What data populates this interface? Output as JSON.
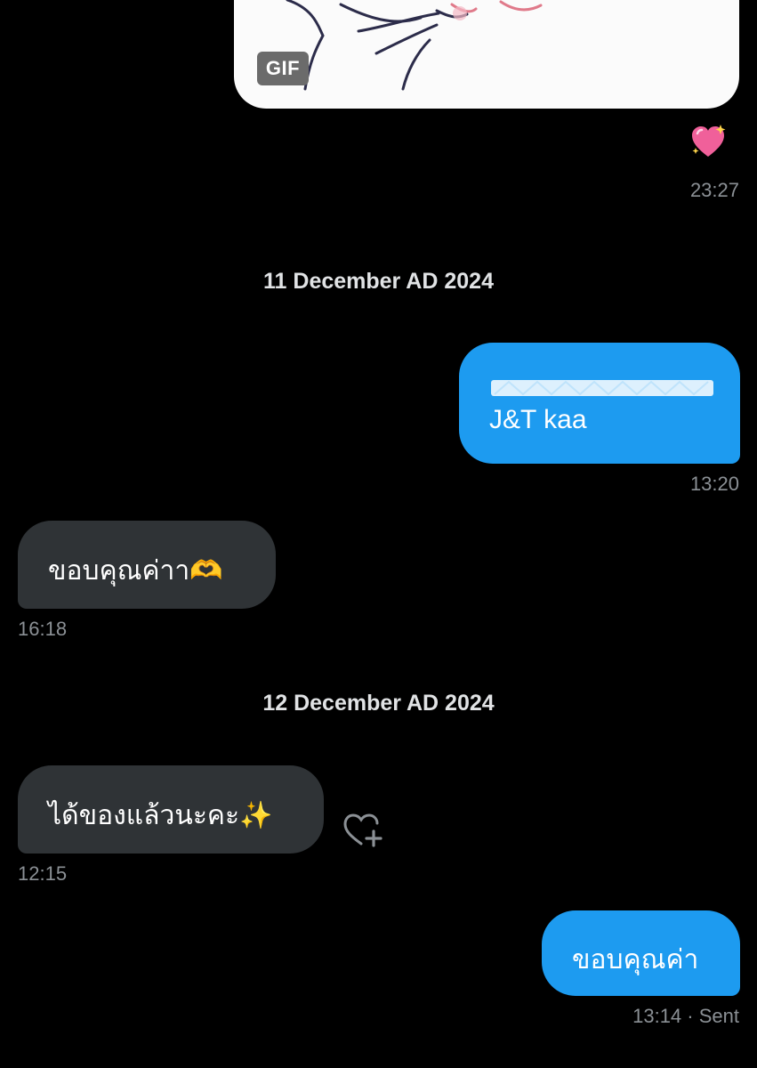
{
  "gif": {
    "badge": "GIF"
  },
  "reaction": {
    "icon": "sparkling-heart-emoji"
  },
  "messages": {
    "gif_time": "23:27",
    "date1": "11 December AD 2024",
    "out1": {
      "text": "J&T kaa",
      "time": "13:20"
    },
    "in1": {
      "text": "ขอบคุณค่าา",
      "emoji": "🫶",
      "time": "16:18"
    },
    "date2": "12 December AD 2024",
    "in2": {
      "text": "ได้ของแล้วนะคะ",
      "emoji": "✨",
      "time": "12:15"
    },
    "out2": {
      "text": "ขอบคุณค่า",
      "time": "13:14",
      "status": "· Sent"
    }
  },
  "colors": {
    "background": "#000000",
    "outgoing_bubble": "#1d9bf0",
    "incoming_bubble": "#2f3336",
    "timestamp": "#8b9095"
  }
}
